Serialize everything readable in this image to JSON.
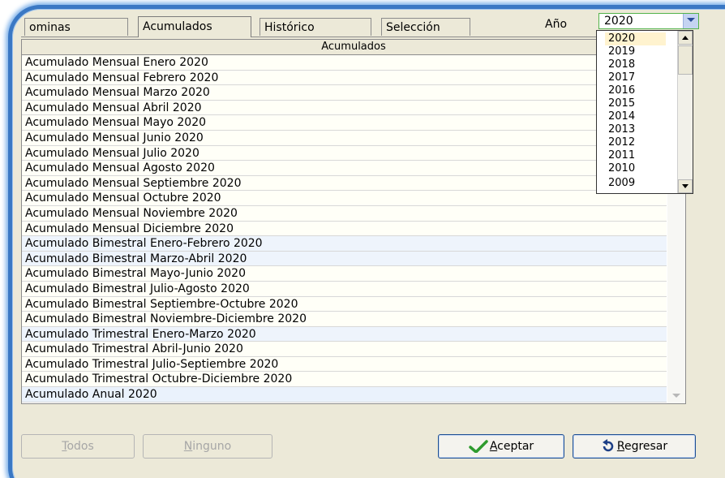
{
  "tabs": [
    {
      "label": "ominas"
    },
    {
      "label": "Acumulados"
    },
    {
      "label": "Histórico"
    },
    {
      "label": "Selección"
    }
  ],
  "year": {
    "label": "Año",
    "value": "2020",
    "options": [
      "2020",
      "2019",
      "2018",
      "2017",
      "2016",
      "2015",
      "2014",
      "2013",
      "2012",
      "2011",
      "2010",
      "2009"
    ]
  },
  "grid": {
    "header": "Acumulados",
    "rows": [
      "Acumulado Mensual Enero 2020",
      "Acumulado Mensual Febrero 2020",
      "Acumulado Mensual Marzo 2020",
      "Acumulado Mensual Abril 2020",
      "Acumulado Mensual Mayo 2020",
      "Acumulado Mensual Junio 2020",
      "Acumulado Mensual Julio 2020",
      "Acumulado Mensual Agosto 2020",
      "Acumulado Mensual Septiembre 2020",
      "Acumulado Mensual Octubre 2020",
      "Acumulado Mensual Noviembre 2020",
      "Acumulado Mensual Diciembre 2020",
      "Acumulado Bimestral Enero-Febrero 2020",
      "Acumulado Bimestral Marzo-Abril 2020",
      "Acumulado Bimestral Mayo-Junio 2020",
      "Acumulado Bimestral Julio-Agosto 2020",
      "Acumulado Bimestral Septiembre-Octubre 2020",
      "Acumulado Bimestral Noviembre-Diciembre 2020",
      "Acumulado Trimestral Enero-Marzo 2020",
      "Acumulado Trimestral Abril-Junio 2020",
      "Acumulado Trimestral Julio-Septiembre 2020",
      "Acumulado Trimestral Octubre-Diciembre 2020",
      "Acumulado Anual 2020"
    ]
  },
  "buttons": {
    "todos": {
      "first": "T",
      "rest": "odos"
    },
    "ninguno": {
      "first": "N",
      "rest": "inguno"
    },
    "aceptar": {
      "first": "A",
      "rest": "ceptar"
    },
    "regresar": {
      "first": "R",
      "rest": "egresar"
    }
  },
  "colors": {
    "window_border": "#3a78c4",
    "accept_icon": "#2e9b2e",
    "back_icon": "#1d3f86"
  }
}
